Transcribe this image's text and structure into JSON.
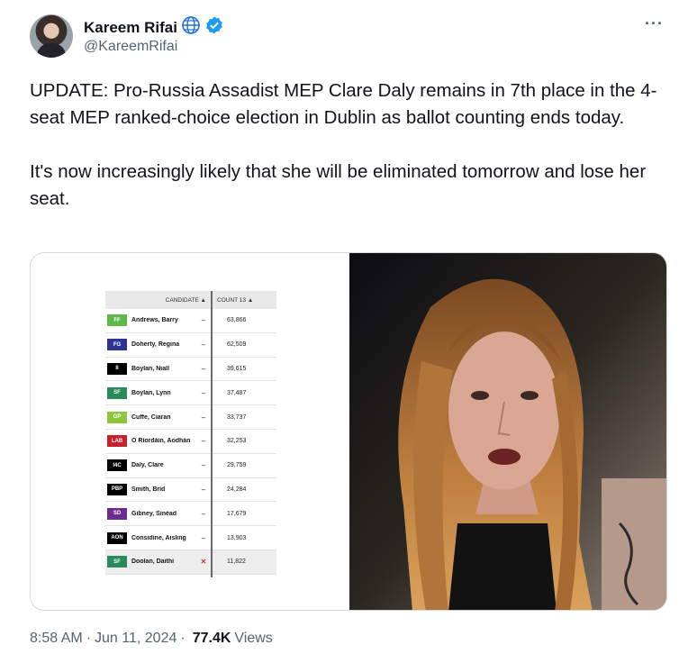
{
  "author": {
    "display_name": "Kareem Rifai",
    "handle": "@KareemRifai"
  },
  "tweet": {
    "paragraphs": [
      "UPDATE: Pro-Russia Assadist MEP Clare Daly remains in 7th place in the 4-seat MEP ranked-choice election in Dublin as ballot counting ends today.",
      "It's now increasingly likely that she will be eliminated tomorrow and lose her seat."
    ]
  },
  "results_table": {
    "header_candidate": "CANDIDATE ▲",
    "header_count": "COUNT 13 ▲",
    "rows": [
      {
        "party": "FF",
        "party_color": "#5fb94a",
        "name": "Andrews, Barry",
        "status": "–",
        "votes": "63,866"
      },
      {
        "party": "FG",
        "party_color": "#2d3594",
        "name": "Doherty, Regina",
        "status": "–",
        "votes": "62,509"
      },
      {
        "party": "II",
        "party_color": "#000000",
        "name": "Boylan, Niall",
        "status": "–",
        "votes": "39,615"
      },
      {
        "party": "SF",
        "party_color": "#2a8a5a",
        "name": "Boylan, Lynn",
        "status": "–",
        "votes": "37,487"
      },
      {
        "party": "GP",
        "party_color": "#8cc63f",
        "name": "Cuffe, Ciaran",
        "status": "–",
        "votes": "33,737"
      },
      {
        "party": "LAB",
        "party_color": "#c8202f",
        "name": "Ó Ríordáin, Aodhán",
        "status": "–",
        "votes": "32,253"
      },
      {
        "party": "I4C",
        "party_color": "#000000",
        "name": "Daly, Clare",
        "status": "–",
        "votes": "29,759"
      },
      {
        "party": "PBP",
        "party_color": "#000000",
        "name": "Smith, Bríd",
        "status": "–",
        "votes": "24,284"
      },
      {
        "party": "SD",
        "party_color": "#6a2c91",
        "name": "Gibney, Sinéad",
        "status": "–",
        "votes": "17,679"
      },
      {
        "party": "AON",
        "party_color": "#000000",
        "name": "Considine, Aisling",
        "status": "–",
        "votes": "13,903"
      },
      {
        "party": "SF",
        "party_color": "#2a8a5a",
        "name": "Doolan, Daithí",
        "status": "✕",
        "votes": "11,822"
      }
    ]
  },
  "footer": {
    "time": "8:58 AM",
    "date": "Jun 11, 2024",
    "views_count": "77.4K",
    "views_label": "Views"
  }
}
